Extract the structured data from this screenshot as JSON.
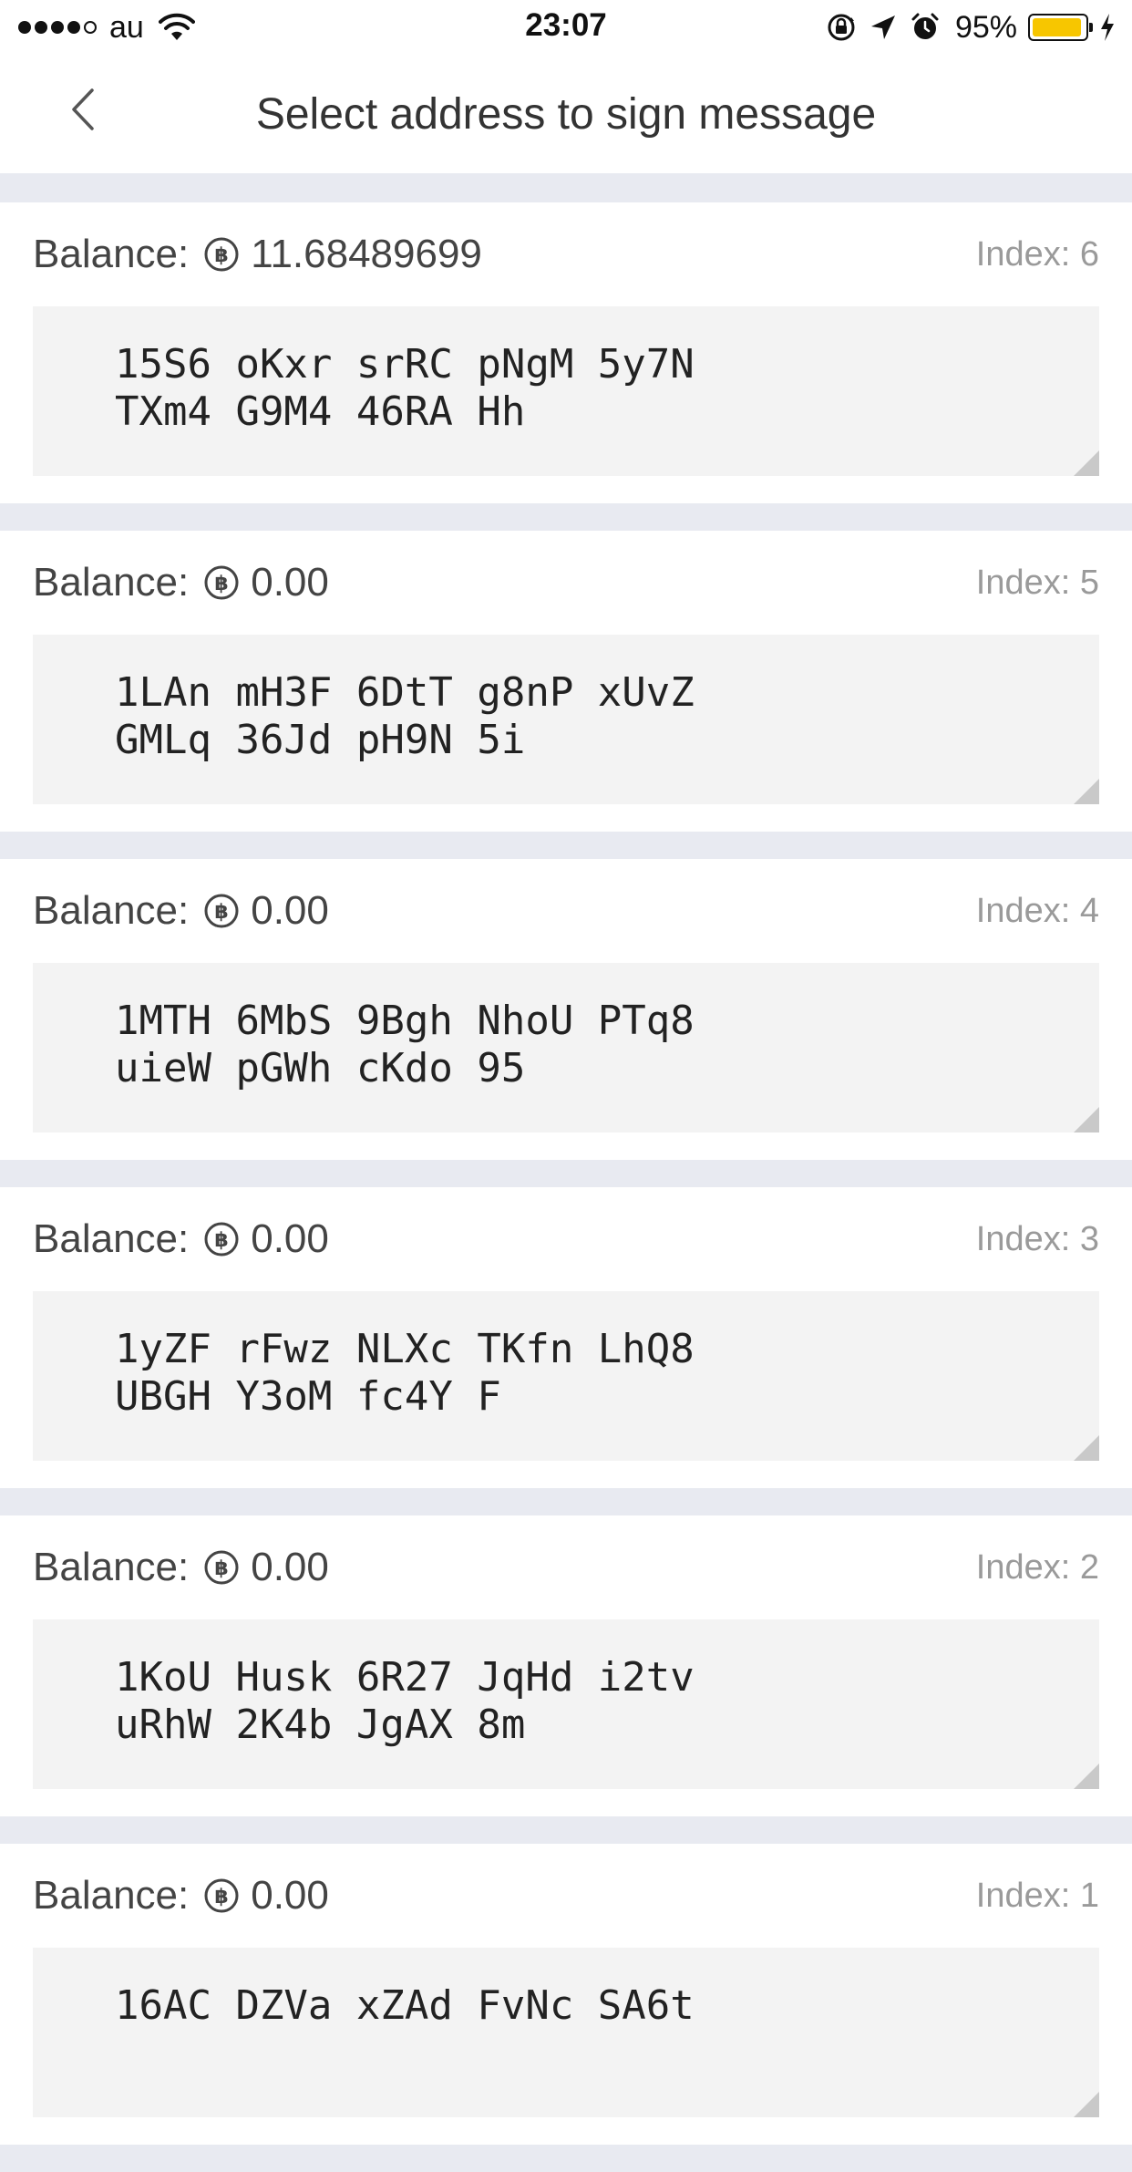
{
  "status_bar": {
    "carrier": "au",
    "time": "23:07",
    "battery_percent": "95%",
    "battery_level": 0.95,
    "battery_color": "#f7c600"
  },
  "nav": {
    "title": "Select address to sign message",
    "back_icon": "chevron-left-icon"
  },
  "addresses": [
    {
      "balance_label": "Balance:",
      "balance": "11.68489699",
      "index": "Index: 6",
      "line1": "15S6 oKxr srRC pNgM 5y7N",
      "line2": "TXm4 G9M4 46RA Hh"
    },
    {
      "balance_label": "Balance:",
      "balance": "0.00",
      "index": "Index: 5",
      "line1": "1LAn mH3F 6DtT g8nP xUvZ",
      "line2": "GMLq 36Jd pH9N 5i"
    },
    {
      "balance_label": "Balance:",
      "balance": "0.00",
      "index": "Index: 4",
      "line1": "1MTH 6MbS 9Bgh NhoU PTq8",
      "line2": "uieW pGWh cKdo 95"
    },
    {
      "balance_label": "Balance:",
      "balance": "0.00",
      "index": "Index: 3",
      "line1": "1yZF rFwz NLXc TKfn LhQ8",
      "line2": "UBGH Y3oM fc4Y F"
    },
    {
      "balance_label": "Balance:",
      "balance": "0.00",
      "index": "Index: 2",
      "line1": "1KoU Husk 6R27 JqHd i2tv",
      "line2": "uRhW 2K4b JgAX 8m"
    },
    {
      "balance_label": "Balance:",
      "balance": "0.00",
      "index": "Index: 1",
      "line1": "16AC DZVa xZAd FvNc SA6t",
      "line2": ""
    }
  ],
  "colors": {
    "page_background": "#e8eaf1",
    "card_background": "#ffffff",
    "address_background": "#f3f3f3",
    "index_text": "#9a9a9a"
  }
}
